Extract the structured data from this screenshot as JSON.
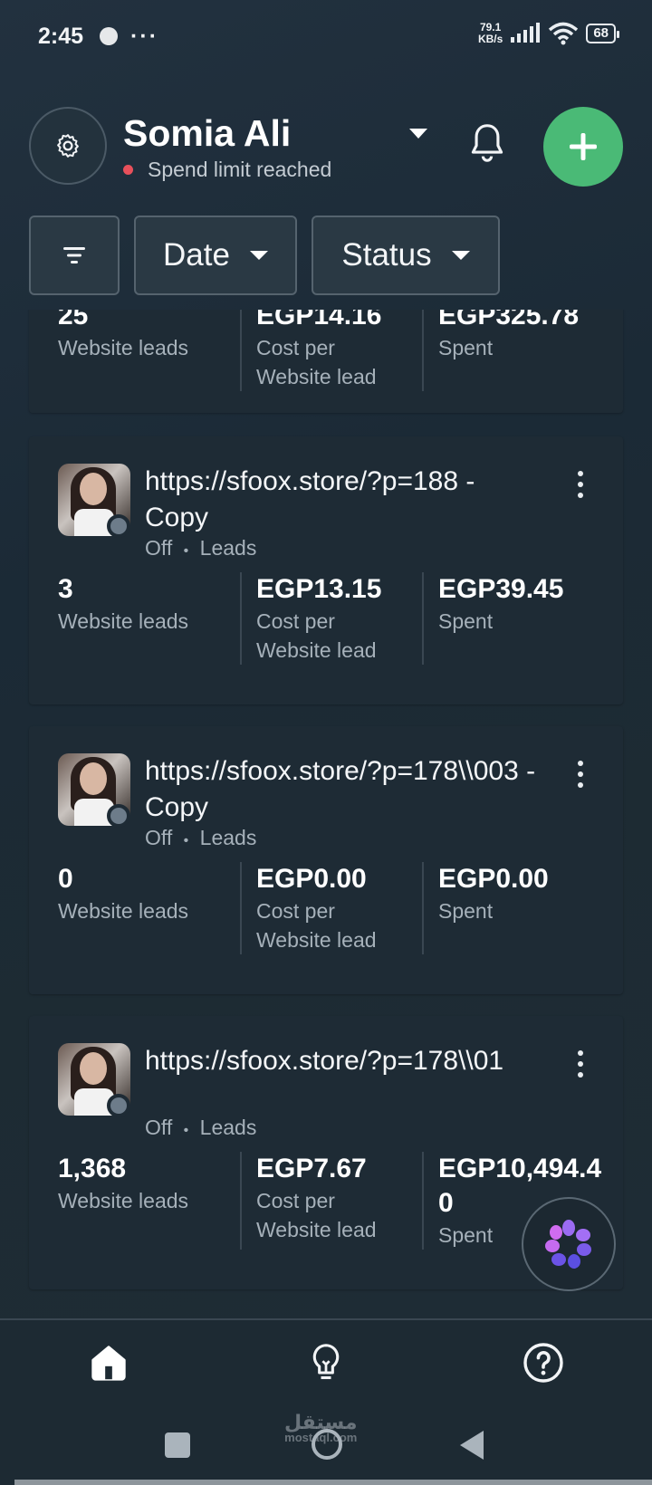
{
  "status_bar": {
    "time": "2:45",
    "more": "···",
    "net_speed_value": "79.1",
    "net_speed_unit": "KB/s",
    "battery": "68"
  },
  "header": {
    "account_name": "Somia Ali",
    "spend_status": "Spend limit reached",
    "status_dot_color": "#e8505b",
    "add_button_color": "#4aba76"
  },
  "filters": {
    "date_label": "Date",
    "status_label": "Status"
  },
  "cards": [
    {
      "title": "",
      "subtitle": "",
      "metrics": [
        {
          "value": "25",
          "label": "Website leads"
        },
        {
          "value": "EGP14.16",
          "label": "Cost per Website lead"
        },
        {
          "value": "EGP325.78",
          "label": "Spent"
        }
      ]
    },
    {
      "title": "https://sfoox.store/?p=188 - Copy",
      "status": "Off",
      "objective": "Leads",
      "metrics": [
        {
          "value": "3",
          "label": "Website leads"
        },
        {
          "value": "EGP13.15",
          "label": "Cost per Website lead"
        },
        {
          "value": "EGP39.45",
          "label": "Spent"
        }
      ]
    },
    {
      "title": "https://sfoox.store/?p=178\\\\003 - Copy",
      "status": "Off",
      "objective": "Leads",
      "metrics": [
        {
          "value": "0",
          "label": "Website leads"
        },
        {
          "value": "EGP0.00",
          "label": "Cost per Website lead"
        },
        {
          "value": "EGP0.00",
          "label": "Spent"
        }
      ]
    },
    {
      "title": "https://sfoox.store/?p=178\\\\01",
      "status": "Off",
      "objective": "Leads",
      "metrics": [
        {
          "value": "1,368",
          "label": "Website leads"
        },
        {
          "value": "EGP7.67",
          "label": "Cost per Website lead"
        },
        {
          "value": "EGP10,494.40",
          "label": "Spent"
        }
      ]
    }
  ],
  "separator": "•",
  "bottom_nav": {
    "items": [
      "home-icon",
      "lightbulb-icon",
      "help-icon"
    ]
  },
  "watermark": {
    "text": "مستقل",
    "sub": "mostaql.com"
  }
}
